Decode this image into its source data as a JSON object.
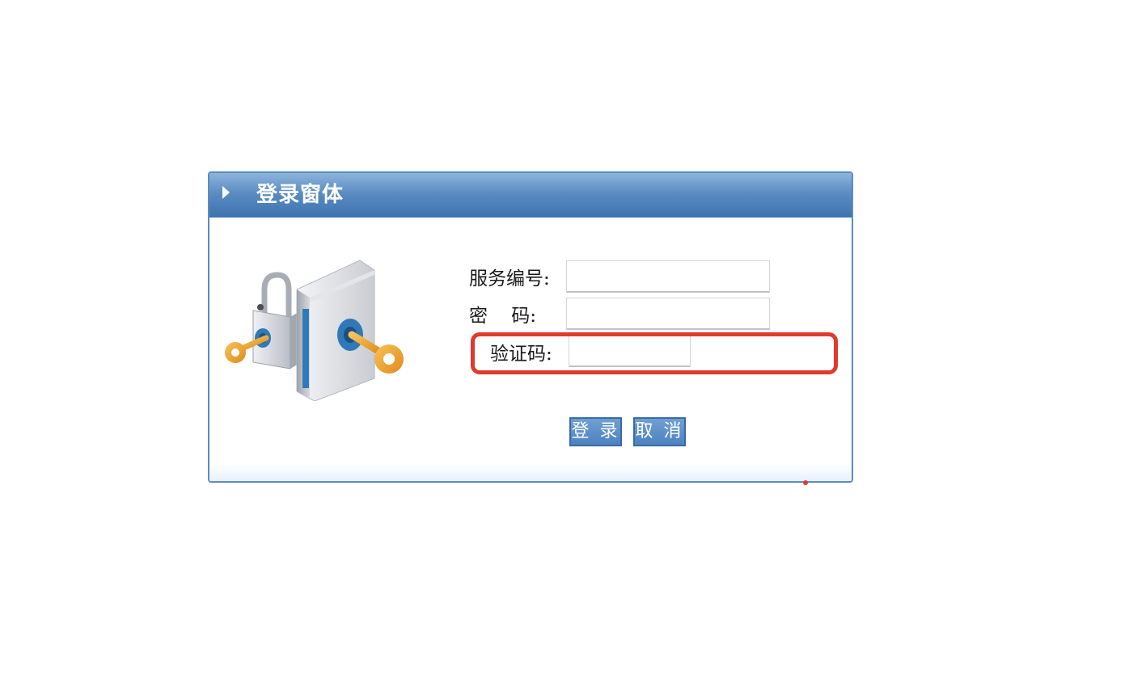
{
  "window": {
    "title": "登录窗体"
  },
  "form": {
    "service_number_label": "服务编号:",
    "service_number_value": "",
    "password_label": "密    码:",
    "password_value": "",
    "captcha_label": "验证码:",
    "captcha_value": ""
  },
  "buttons": {
    "login_label": "登 录",
    "cancel_label": "取 消"
  },
  "colors": {
    "title_bar": "#3d73b0",
    "window_border": "#5b8cc2",
    "button": "#4d82c0",
    "highlight": "#e03a2c"
  },
  "icons": {
    "title_arrow": "triangle-right-icon",
    "illustration": "padlock-and-key-illustration"
  }
}
